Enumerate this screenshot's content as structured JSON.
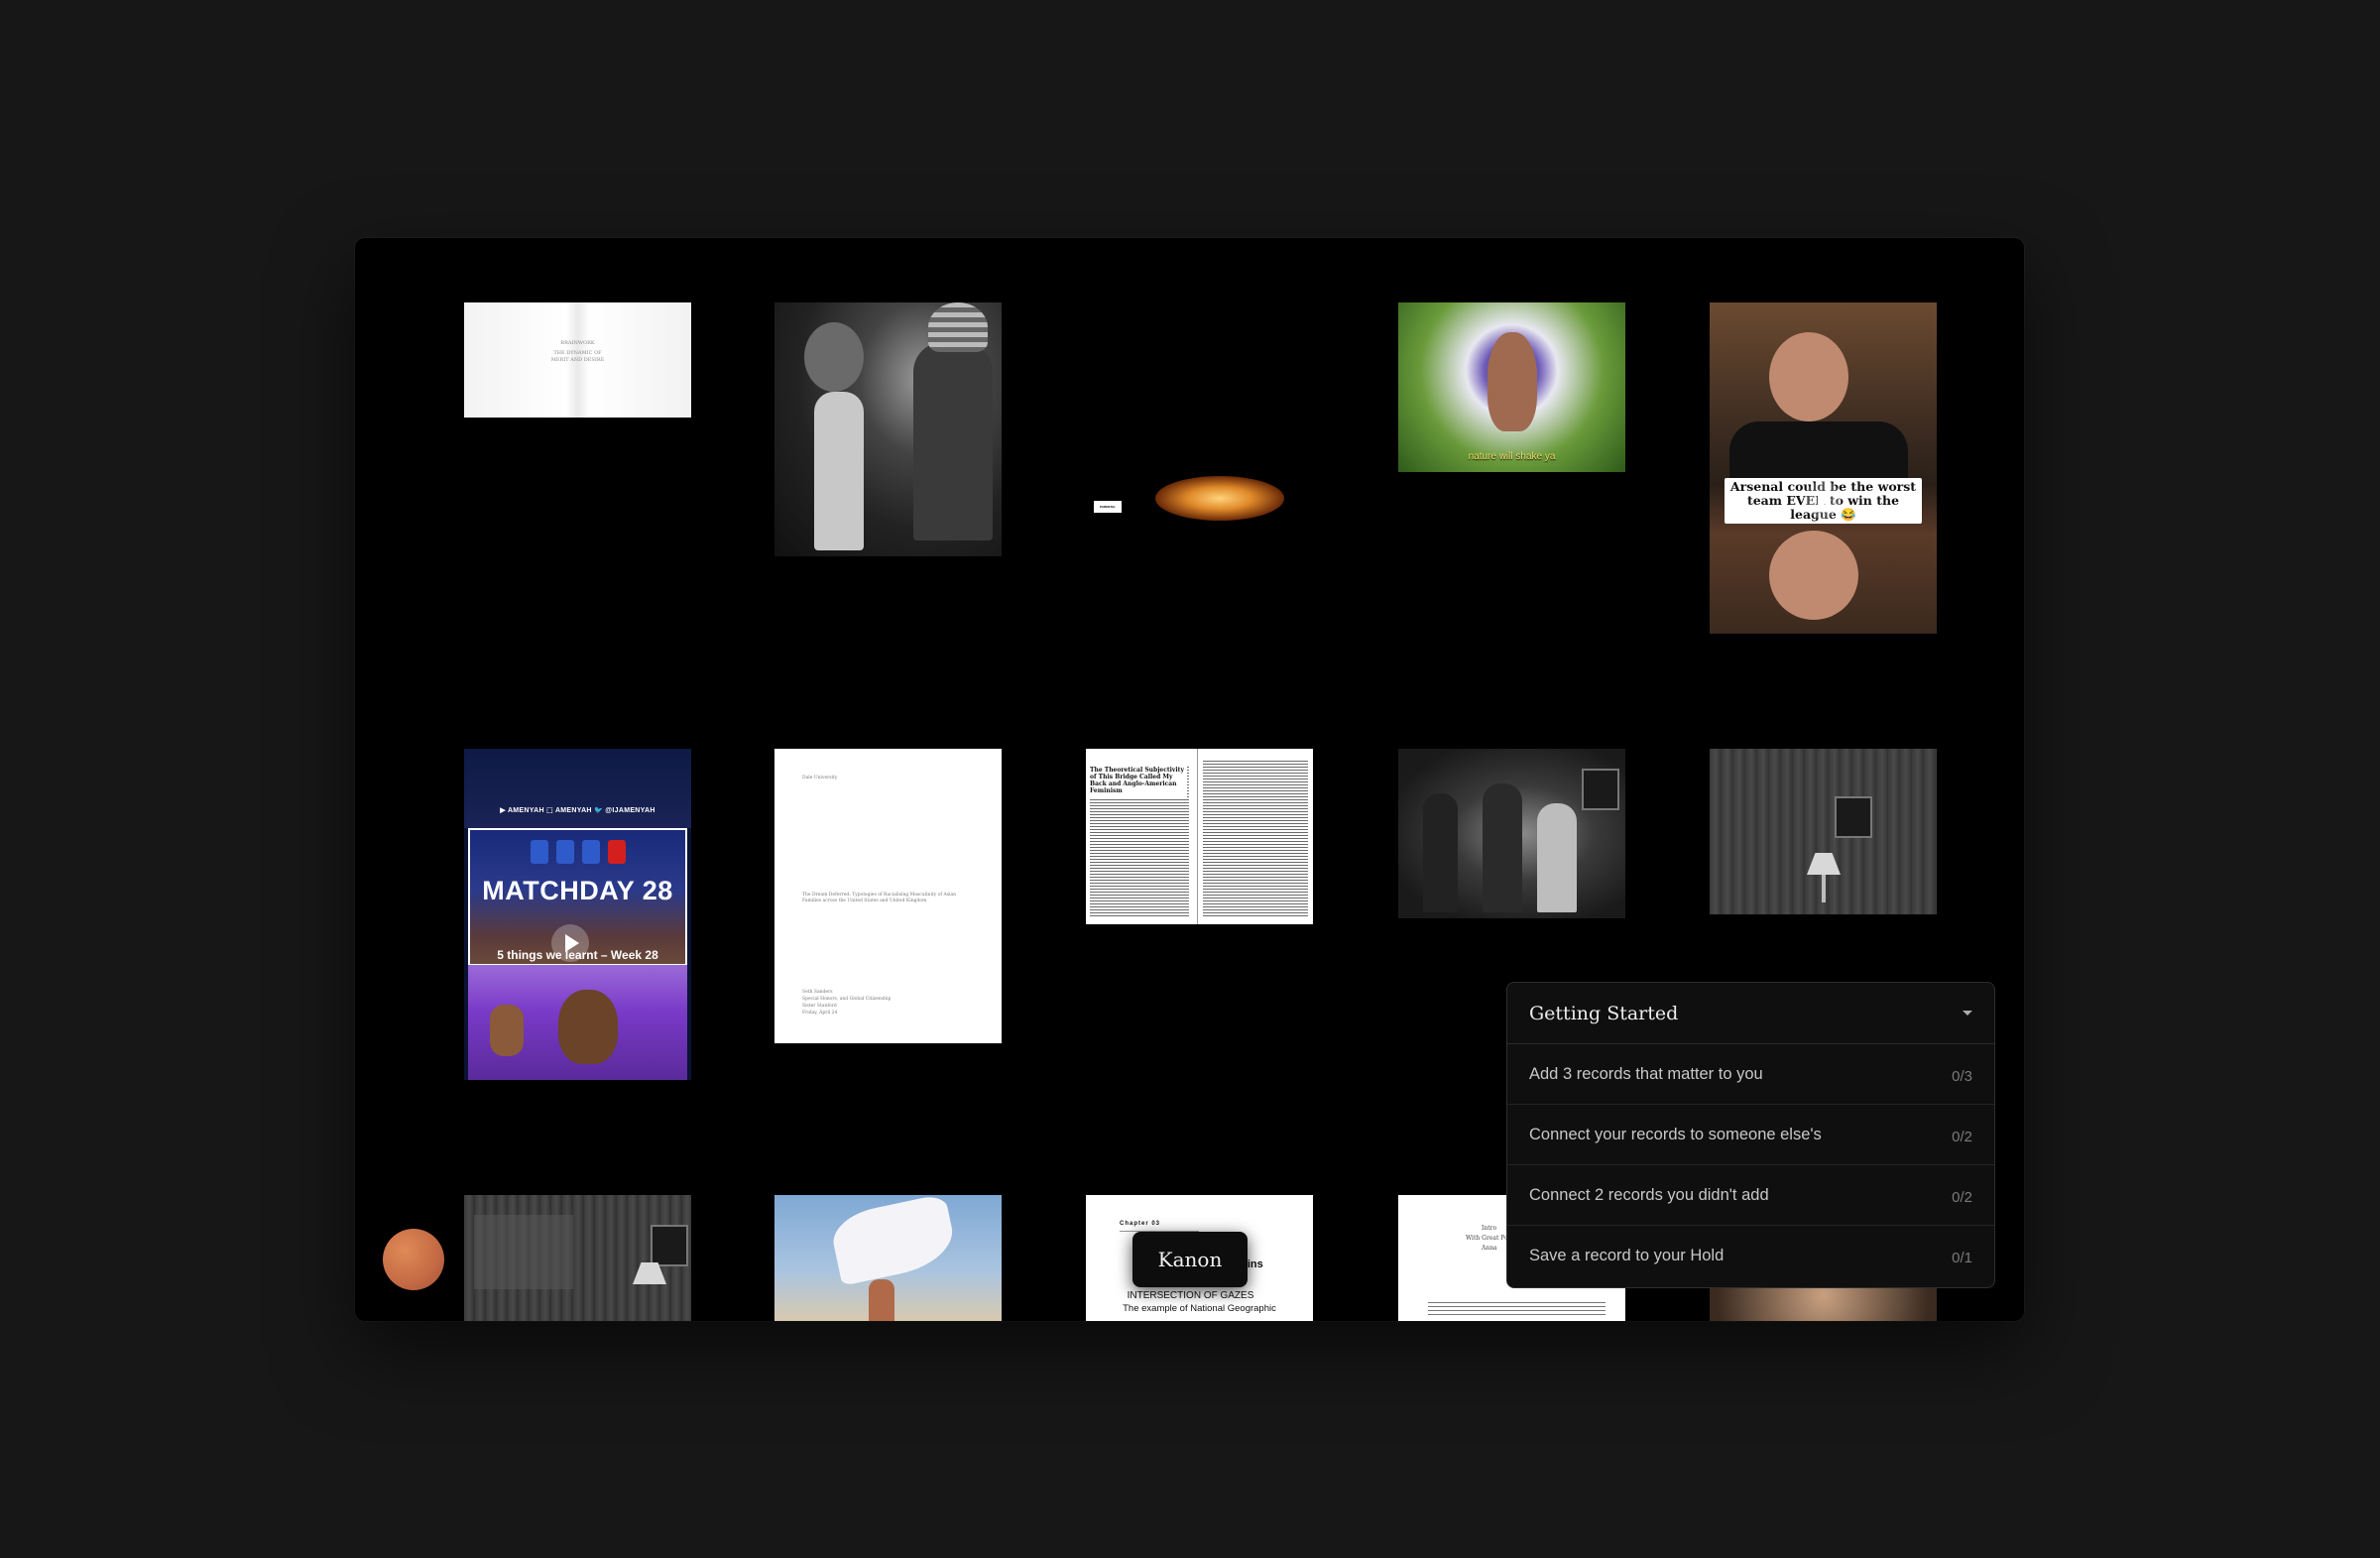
{
  "grid": {
    "book_title_lines": [
      "BRAINWORK",
      "",
      "THE DYNAMIC OF",
      "MERIT AND DESIRE"
    ],
    "flower_subtitle": "nature will shake ya",
    "arsenal_caption": "Arsenal could be the worst team EVER to win the league 😂",
    "fire_badge": "PARENTAL ADVISORY",
    "matchday": {
      "social": "▶ AMENYAH   ⬚ AMENYAH   🐦 @IJAMENYAH",
      "title": "MATCHDAY 28",
      "subtitle": "5 things we learnt – Week 28"
    },
    "doc_lines": [
      "Dale University",
      "The Dream Deferred: Typologies of Racialising Masculinity of Asian Families across the United States and United Kingdom",
      "Seth Sanders",
      "Special Honors, and Global Citizenship",
      "Sister Stanford",
      "Friday, April 24"
    ],
    "article_heading": "The Theoretical Subjectivity of This Bridge Called My Back and Anglo-American Feminism",
    "chapter": {
      "label": "Chapter 03",
      "name_fragment": "ollins",
      "heading": "INTERSECTION OF GAZES",
      "subheading": "The example of National Geographic"
    },
    "intro_lines": [
      "Intro",
      "With Great Power Comes...",
      "Anna"
    ]
  },
  "tooltip": {
    "label": "Kanon"
  },
  "getting_started": {
    "title": "Getting Started",
    "tasks": [
      {
        "label": "Add 3 records that matter to you",
        "count": "0/3"
      },
      {
        "label": "Connect your records to someone else's",
        "count": "0/2"
      },
      {
        "label": "Connect 2 records you didn't add",
        "count": "0/2"
      },
      {
        "label": "Save a record to your Hold",
        "count": "0/1"
      }
    ]
  },
  "colors": {
    "background": "#171717",
    "canvas": "#000000",
    "panel": "#0f0f0f",
    "avatar": "#c46a45"
  }
}
